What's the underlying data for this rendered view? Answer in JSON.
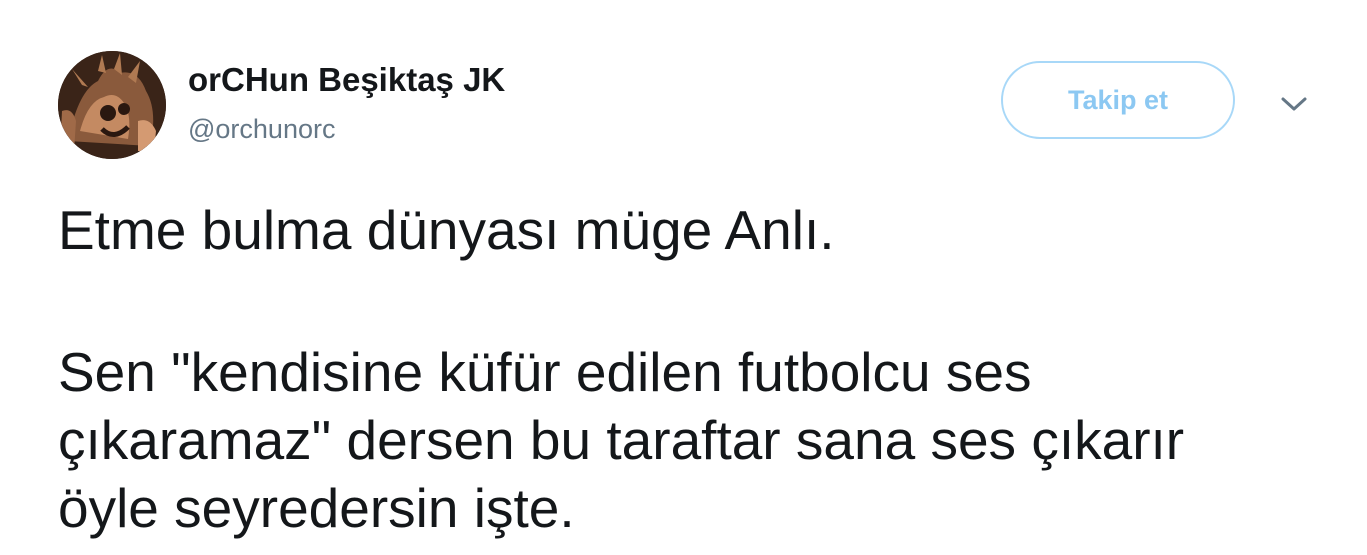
{
  "tweet": {
    "author": {
      "display_name": "orCHun Beşiktaş JK",
      "handle": "@orchunorc",
      "avatar_icon": "avatar-image"
    },
    "follow_label": "Takip et",
    "menu_icon": "chevron-down-icon",
    "text_lines": [
      "Etme bulma dünyası müge Anlı.",
      "Sen \"kendisine küfür edilen futbolcu ses",
      "çıkaramaz\" dersen bu taraftar sana ses çıkarır",
      "öyle seyredersin işte."
    ]
  },
  "colors": {
    "text": "#14171a",
    "secondary_text": "#657786",
    "follow_border": "#a8d8f8",
    "follow_text": "#8cc8f2"
  }
}
